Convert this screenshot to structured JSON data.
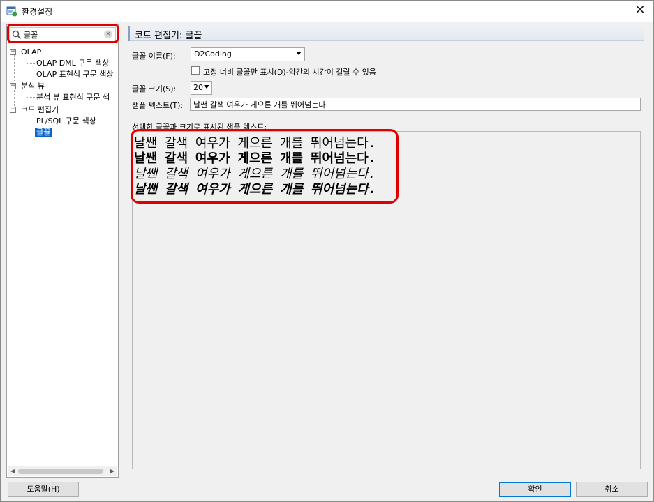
{
  "window": {
    "title": "환경설정",
    "close_glyph": "✕"
  },
  "search": {
    "value": "글꼴",
    "clear_glyph": "×"
  },
  "tree": {
    "items": [
      {
        "label": "OLAP",
        "expander": "−"
      },
      {
        "label": "OLAP DML 구문 색상"
      },
      {
        "label": "OLAP 표현식 구문 색상"
      },
      {
        "label": "분석 뷰",
        "expander": "−"
      },
      {
        "label": "분석 뷰 표현식 구문 색"
      },
      {
        "label": "코드 편집기",
        "expander": "−"
      },
      {
        "label": "PL/SQL 구문 색상"
      },
      {
        "label": "글꼴",
        "selected": true
      }
    ]
  },
  "section": {
    "title": "코드 편집기: 글꼴"
  },
  "form": {
    "font_name_label": "글꼴 이름(F):",
    "font_name_value": "D2Coding",
    "fixed_width_label": "고정 너비 글꼴만 표시(D)-약간의 시간이 걸릴 수 있음",
    "font_size_label": "글꼴 크기(S):",
    "font_size_value": "20",
    "sample_label": "샘플 텍스트(T):",
    "sample_value": "날쌘 갈색 여우가 게으른 개를 뛰어넘는다.",
    "preview_label": "선택한 글꼴과 크기로 표시된 샘플 텍스트:"
  },
  "preview": {
    "lines": [
      {
        "text": "날쌘 갈색 여우가 게으른 개를 뛰어넘는다.",
        "style": "regular"
      },
      {
        "text": "날쌘 갈색 여우가 게으른 개를 뛰어넘는다.",
        "style": "bold"
      },
      {
        "text": "날쌘 갈색 여우가 게으른 개를 뛰어넘는다.",
        "style": "italic"
      },
      {
        "text": "날쌘 갈색 여우가 게으른 개를 뛰어넘는다.",
        "style": "bold-italic"
      }
    ]
  },
  "buttons": {
    "help": "도움말(H)",
    "ok": "확인",
    "cancel": "취소"
  },
  "colors": {
    "highlight": "#e00000",
    "selection": "#0a64c8"
  }
}
